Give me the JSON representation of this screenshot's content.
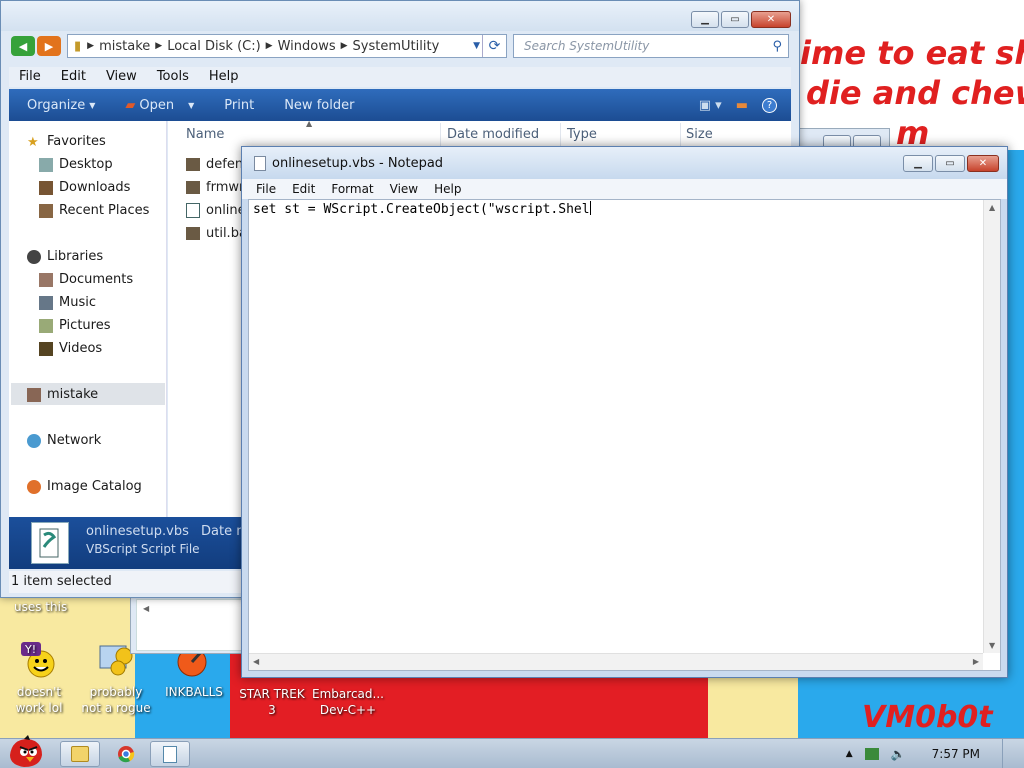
{
  "explorer": {
    "title": "",
    "breadcrumb": [
      "mistake",
      "Local Disk (C:)",
      "Windows",
      "SystemUtility"
    ],
    "search_placeholder": "Search SystemUtility",
    "menu": [
      "File",
      "Edit",
      "View",
      "Tools",
      "Help"
    ],
    "toolbar": {
      "organize": "Organize",
      "open": "Open",
      "print": "Print",
      "new_folder": "New folder"
    },
    "nav_pane": {
      "favorites": "Favorites",
      "desktop": "Desktop",
      "downloads": "Downloads",
      "recent_places": "Recent Places",
      "libraries": "Libraries",
      "documents": "Documents",
      "music": "Music",
      "pictures": "Pictures",
      "videos": "Videos",
      "homegroup_user": "mistake",
      "network": "Network",
      "image_catalog": "Image Catalog"
    },
    "columns": {
      "name": "Name",
      "date_modified": "Date modified",
      "type": "Type",
      "size": "Size"
    },
    "files": [
      "defen",
      "frmwr",
      "online",
      "util.ba"
    ],
    "details": {
      "file_name": "onlinesetup.vbs",
      "file_type": "VBScript Script File",
      "date_label": "Date m"
    },
    "status": "1 item selected"
  },
  "notepad": {
    "title": "onlinesetup.vbs - Notepad",
    "menu": [
      "File",
      "Edit",
      "Format",
      "View",
      "Help"
    ],
    "content": "set st = WScript.CreateObject(\"wscript.Shel"
  },
  "desktop": {
    "graffiti": [
      "ime to eat shit",
      "die and chew",
      "m"
    ],
    "signature": "VM0b0t",
    "partial_text": "uses this",
    "icons": [
      {
        "label": "doesn't work lol",
        "icon": "yahoo-messenger-icon"
      },
      {
        "label": "probably not a rogue",
        "icon": "system-settings-icon"
      },
      {
        "label": "INKBALLS",
        "icon": "inkball-icon"
      },
      {
        "label": "STAR TREK 3",
        "icon": "star-trek-icon"
      },
      {
        "label": "Embarcad... Dev-C++",
        "icon": "dev-cpp-icon"
      }
    ]
  },
  "taskbar": {
    "clock": "7:57 PM",
    "pinned": [
      "explorer-icon",
      "chrome-icon",
      "notepad-icon"
    ]
  }
}
